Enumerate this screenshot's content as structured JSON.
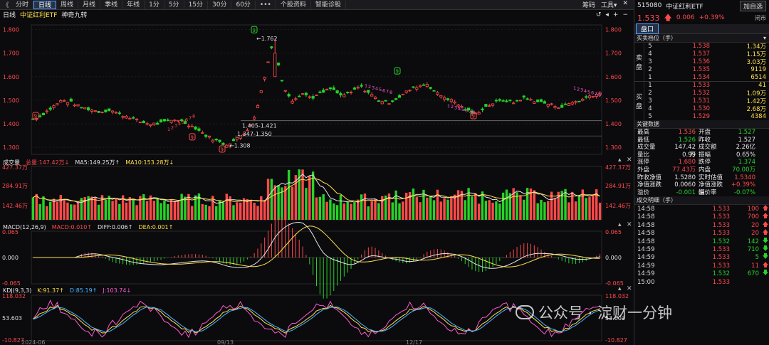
{
  "topbar": {
    "nav_back": "《",
    "tabs": [
      "分时",
      "日线",
      "周线",
      "月线",
      "季线",
      "年线",
      "1分",
      "5分",
      "15分",
      "30分",
      "60分",
      "•••",
      "个股资料",
      "智能诊股"
    ],
    "active_tab": 1,
    "right": [
      "筹码",
      "工具▾",
      "✕"
    ]
  },
  "subhead": {
    "period": "日线",
    "name": "中证红利ETF",
    "indicator": "神奇九转",
    "ctrls": [
      "↺",
      "◂",
      "+",
      "−"
    ]
  },
  "price_axis": {
    "ticks": [
      "1.800",
      "1.700",
      "1.600",
      "1.500",
      "1.400",
      "1.300"
    ],
    "values": [
      1.8,
      1.7,
      1.6,
      1.5,
      1.4,
      1.3
    ]
  },
  "annotations": {
    "high": "1.762",
    "range1": "1.405-1.421",
    "range2": "1.347-1.350",
    "low": "1.308",
    "nine_marks": [
      "9",
      "9",
      "9",
      "9",
      "9",
      "9"
    ],
    "seq": [
      "1",
      "2",
      "3",
      "4",
      "5",
      "6",
      "7",
      "8"
    ]
  },
  "volume": {
    "label": "成交量",
    "total": "总量:147.42万↓",
    "ma5": "MA5:149.25万↑",
    "ma10": "MA10:153.28万↓",
    "ticks": [
      "427.37万",
      "284.91万",
      "142.46万"
    ]
  },
  "macd": {
    "label": "MACD(12,26,9)",
    "macd": "MACD:0.010↑",
    "diff": "DIFF:0.006↑",
    "dea": "DEA:0.001↑",
    "ticks": [
      "0.065",
      "0.000",
      "-0.065"
    ]
  },
  "kdj": {
    "label": "KDJ(9,3,3)",
    "k": "K:91.37↑",
    "d": "D:85.19↑",
    "j": "J:103.74↓",
    "ticks": [
      "118.032",
      "53.603",
      "-10.827"
    ]
  },
  "dates": [
    "2024-06",
    "09/13",
    "12/17"
  ],
  "side": {
    "code": "515080",
    "name": "中证红利ETF",
    "add_btn": "加自选",
    "price": "1.533",
    "change": "0.006",
    "pct": "+0.39%",
    "status": "闭市",
    "tab": "盘口",
    "ob_title": "买卖档位（手）",
    "ob_collapse": "▾",
    "sell_label": [
      "卖",
      "盘"
    ],
    "buy_label": [
      "买",
      "盘"
    ],
    "asks": [
      {
        "lv": "5",
        "px": "1.538",
        "vol": "1.34万"
      },
      {
        "lv": "4",
        "px": "1.537",
        "vol": "1.15万"
      },
      {
        "lv": "3",
        "px": "1.536",
        "vol": "3.03万"
      },
      {
        "lv": "2",
        "px": "1.535",
        "vol": "9119"
      },
      {
        "lv": "1",
        "px": "1.534",
        "vol": "6514"
      }
    ],
    "bids": [
      {
        "lv": "1",
        "px": "1.533",
        "vol": "41"
      },
      {
        "lv": "2",
        "px": "1.532",
        "vol": "1.09万"
      },
      {
        "lv": "3",
        "px": "1.531",
        "vol": "1.42万"
      },
      {
        "lv": "4",
        "px": "1.530",
        "vol": "2.68万"
      },
      {
        "lv": "5",
        "px": "1.529",
        "vol": "4384"
      }
    ],
    "kd_title": "关键数据",
    "kd": [
      [
        "最高",
        "1.536",
        "开盘",
        "1.527"
      ],
      [
        "最低",
        "1.526",
        "昨收",
        "1.527"
      ],
      [
        "成交量",
        "147.42万",
        "成交额",
        "2.26亿"
      ],
      [
        "量比",
        "0.99",
        "振幅",
        "0.65%"
      ],
      [
        "涨停",
        "1.680",
        "跌停",
        "1.374"
      ],
      [
        "外盘",
        "77.43万",
        "内盘",
        "70.00万"
      ],
      [
        "昨收净值",
        "1.5280",
        "实时估值",
        "1.5340"
      ],
      [
        "净值涨跌",
        "0.0060",
        "净值涨跌幅",
        "+0.39%"
      ],
      [
        "溢价",
        "-0.001",
        "溢价率",
        "-0.07%"
      ]
    ],
    "kd_colors": [
      [
        "up",
        "dn"
      ],
      [
        "dn",
        "wh"
      ],
      [
        "wh",
        "wh"
      ],
      [
        "wh",
        "wh"
      ],
      [
        "up",
        "dn"
      ],
      [
        "up",
        "dn"
      ],
      [
        "wh",
        "up"
      ],
      [
        "wh",
        "up"
      ],
      [
        "dn",
        "dn"
      ]
    ],
    "tk_title": "成交明细（手）",
    "ticks": [
      {
        "tm": "14:58",
        "px": "1.533",
        "vol": "100",
        "dir": "up"
      },
      {
        "tm": "14:58",
        "px": "1.533",
        "vol": "700",
        "dir": "up"
      },
      {
        "tm": "14:58",
        "px": "1.533",
        "vol": "20",
        "dir": "up"
      },
      {
        "tm": "14:58",
        "px": "1.533",
        "vol": "20",
        "dir": "up"
      },
      {
        "tm": "14:58",
        "px": "1.532",
        "vol": "142",
        "dir": "dn"
      },
      {
        "tm": "14:59",
        "px": "1.533",
        "vol": "710",
        "dir": "dn"
      },
      {
        "tm": "14:59",
        "px": "1.533",
        "vol": "5",
        "dir": "dn"
      },
      {
        "tm": "14:59",
        "px": "1.533",
        "vol": "11",
        "dir": "up"
      },
      {
        "tm": "14:59",
        "px": "1.532",
        "vol": "670",
        "dir": "dn"
      },
      {
        "tm": "15:00",
        "px": "1.533",
        "vol": "",
        "dir": ""
      }
    ]
  },
  "watermark": "公众号 · 淀财一分钟",
  "colors": {
    "up": "#ff4a4a",
    "down": "#27d327",
    "ma5": "#e6e6e6",
    "ma10": "#ffe04a",
    "k": "#e6e6e6",
    "d": "#ffe04a",
    "j": "#ff5ad0",
    "dea": "#ffe04a"
  },
  "chart_data": {
    "type": "candlestick",
    "ylim": [
      1.27,
      1.82
    ],
    "close_path": [
      1.42,
      1.44,
      1.47,
      1.5,
      1.49,
      1.47,
      1.46,
      1.45,
      1.46,
      1.44,
      1.43,
      1.41,
      1.4,
      1.4,
      1.41,
      1.42,
      1.4,
      1.38,
      1.35,
      1.33,
      1.31,
      1.33,
      1.36,
      1.42,
      1.58,
      1.76,
      1.56,
      1.5,
      1.53,
      1.51,
      1.53,
      1.55,
      1.52,
      1.53,
      1.56,
      1.53,
      1.5,
      1.49,
      1.51,
      1.54,
      1.56,
      1.57,
      1.53,
      1.51,
      1.49,
      1.46,
      1.44,
      1.47,
      1.49,
      1.5,
      1.49,
      1.51,
      1.5,
      1.49,
      1.48,
      1.47,
      1.49,
      1.5,
      1.52,
      1.53
    ]
  }
}
